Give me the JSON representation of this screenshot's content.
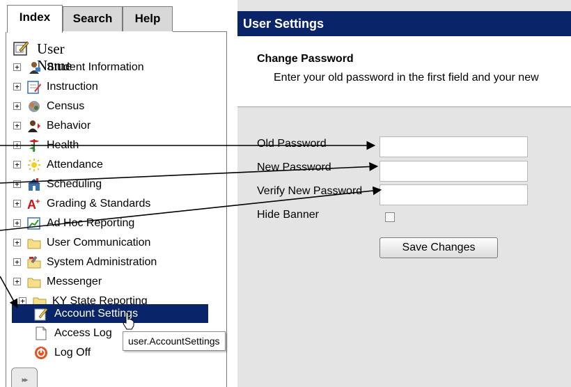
{
  "tabs": {
    "index": "Index",
    "search": "Search",
    "help": "Help"
  },
  "tree": {
    "root_label": "User Name",
    "items": [
      {
        "label": "Student Information",
        "icon": "student-icon"
      },
      {
        "label": "Instruction",
        "icon": "instruction-icon"
      },
      {
        "label": "Census",
        "icon": "census-icon"
      },
      {
        "label": "Behavior",
        "icon": "behavior-icon"
      },
      {
        "label": "Health",
        "icon": "health-icon"
      },
      {
        "label": "Attendance",
        "icon": "attendance-icon"
      },
      {
        "label": "Scheduling",
        "icon": "scheduling-icon"
      },
      {
        "label": "Grading & Standards",
        "icon": "grading-icon"
      },
      {
        "label": "Ad Hoc Reporting",
        "icon": "reporting-icon"
      },
      {
        "label": "User Communication",
        "icon": "folder-icon"
      },
      {
        "label": "System Administration",
        "icon": "admin-icon"
      },
      {
        "label": "Messenger",
        "icon": "folder-icon"
      },
      {
        "label": "KY State Reporting",
        "icon": "folder-icon"
      }
    ],
    "leaf_items": [
      {
        "label": "Account Settings",
        "icon": "account-settings-icon",
        "selected": true
      },
      {
        "label": "Access Log",
        "icon": "document-icon"
      },
      {
        "label": "Log Off",
        "icon": "log-off-icon"
      }
    ]
  },
  "tooltip": "user.AccountSettings",
  "settings": {
    "header": "User Settings",
    "change_password_title": "Change Password",
    "change_password_desc": "Enter your old password in the first field and your new",
    "old_password_label": "Old Password",
    "new_password_label": "New Password",
    "verify_password_label": "Verify New Password",
    "hide_banner_label": "Hide Banner",
    "save_button": "Save Changes",
    "old_password_value": "",
    "new_password_value": "",
    "verify_password_value": "",
    "hide_banner_checked": false
  },
  "colors": {
    "header_bg": "#0a246a",
    "selected_bg": "#0a246a",
    "panel_bg": "#e4e4e4",
    "tab_bg": "#d8d8d8"
  }
}
